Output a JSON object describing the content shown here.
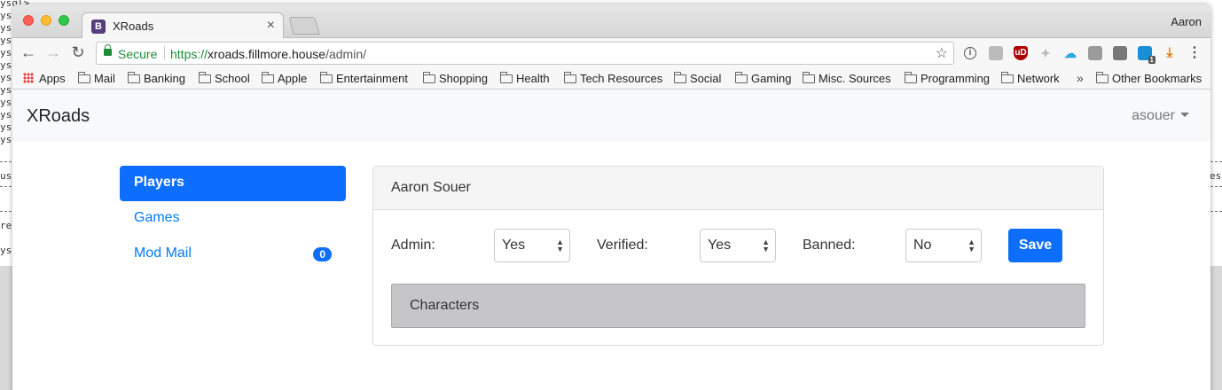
{
  "terminal": {
    "left_lines": [
      "ysql>",
      "ysq",
      "ysq",
      "ysq",
      "ysq",
      "ysq",
      "ysq",
      "ysq",
      "ysq",
      "ysq",
      "ysq",
      "ysq"
    ],
    "fragment_us": "us",
    "fragment_re": "re",
    "fragment_ysq": "ysq",
    "right_fragment": "es"
  },
  "browser": {
    "tab_title": "XRoads",
    "tab_favicon_letter": "B",
    "tab_close": "×",
    "profile_name": "Aaron",
    "address": {
      "secure_label": "Secure",
      "url_scheme": "https://",
      "url_host": "xroads.fillmore.house",
      "url_path": "/admin/"
    },
    "nav": {
      "back": "←",
      "forward": "→",
      "reload": "↻"
    },
    "extensions": [
      "info",
      "camera",
      "ublock",
      "dropbox",
      "icloud",
      "pin",
      "shield",
      "skype",
      "download",
      "menu"
    ],
    "ublock_label": "uD",
    "skype_badge": "1",
    "bookmarks": [
      {
        "label": "Apps",
        "icon": "apps-grid-icon"
      },
      {
        "label": "Mail",
        "icon": "folder-icon"
      },
      {
        "label": "Banking",
        "icon": "folder-icon"
      },
      {
        "label": "School",
        "icon": "folder-icon"
      },
      {
        "label": "Apple",
        "icon": "folder-icon"
      },
      {
        "label": "Entertainment",
        "icon": "folder-icon"
      },
      {
        "label": "Shopping",
        "icon": "folder-icon"
      },
      {
        "label": "Health",
        "icon": "folder-icon"
      },
      {
        "label": "Tech Resources",
        "icon": "folder-icon"
      },
      {
        "label": "Social",
        "icon": "folder-icon"
      },
      {
        "label": "Gaming",
        "icon": "folder-icon"
      },
      {
        "label": "Misc. Sources",
        "icon": "folder-icon"
      },
      {
        "label": "Programming",
        "icon": "folder-icon"
      },
      {
        "label": "Network",
        "icon": "folder-icon"
      }
    ],
    "bookmarks_overflow": "»",
    "other_bookmarks": "Other Bookmarks"
  },
  "site": {
    "brand": "XRoads",
    "user": "asouer",
    "sidebar": [
      {
        "label": "Players",
        "active": true
      },
      {
        "label": "Games",
        "active": false
      },
      {
        "label": "Mod Mail",
        "active": false,
        "badge": "0"
      }
    ],
    "player": {
      "name": "Aaron Souer",
      "admin_label": "Admin:",
      "admin_value": "Yes",
      "verified_label": "Verified:",
      "verified_value": "Yes",
      "banned_label": "Banned:",
      "banned_value": "No",
      "save_label": "Save",
      "characters_label": "Characters"
    }
  },
  "colors": {
    "primary": "#0d6efd",
    "secure_green": "#1e8a3a",
    "bootstrap_purple": "#563d7c",
    "characters_bg": "#c6c6c9"
  }
}
